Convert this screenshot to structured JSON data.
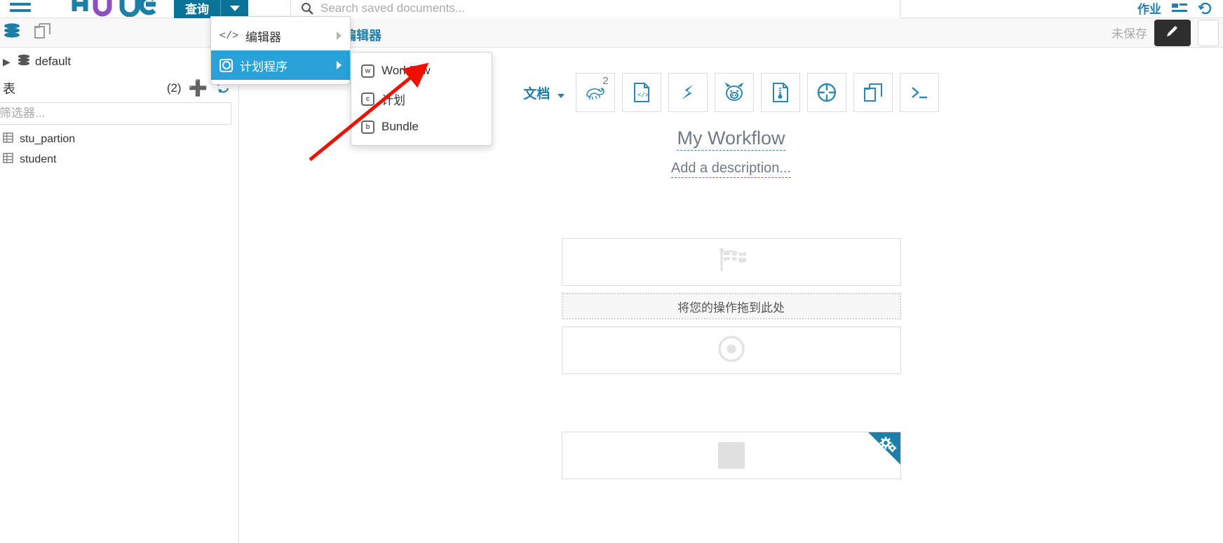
{
  "header": {
    "menu_icon": "hamburger-icon",
    "logo_text": "hue",
    "query_button_label": "查询",
    "search": {
      "placeholder": "Search saved documents...",
      "value": ""
    },
    "jobs_label": "作业",
    "jobs_icon": "jobs-list-icon",
    "history_icon": "history-icon"
  },
  "subbar": {
    "db_icon": "database-icon",
    "docs_icon": "documents-icon",
    "trash_icon": "trash-icon",
    "editor_tab_label": "编辑器",
    "unsaved_label": "未保存",
    "edit_icon": "pencil-icon"
  },
  "dropdown": {
    "items": [
      {
        "label": "编辑器",
        "icon": "code-icon",
        "active": false,
        "has_submenu": true
      },
      {
        "label": "计划程序",
        "icon": "scheduler-icon",
        "active": true,
        "has_submenu": true
      }
    ]
  },
  "submenu": {
    "items": [
      {
        "label": "Workflow",
        "icon": "workflow-icon",
        "badge": "w"
      },
      {
        "label": "计划",
        "icon": "coordinator-icon",
        "badge": "c"
      },
      {
        "label": "Bundle",
        "icon": "bundle-icon",
        "badge": "b"
      }
    ]
  },
  "sidebar": {
    "database": {
      "name": "default",
      "icon": "database-icon"
    },
    "tables_label": "表",
    "tables_count": "(2)",
    "add_icon": "plus-icon",
    "refresh_icon": "refresh-icon",
    "filter": {
      "placeholder": "筛选器...",
      "value": ""
    },
    "tables": [
      {
        "name": "stu_partion",
        "icon": "table-icon"
      },
      {
        "name": "student",
        "icon": "table-icon"
      }
    ]
  },
  "main": {
    "docs_label": "文档",
    "tools": [
      {
        "name": "hive-icon",
        "badge": "2"
      },
      {
        "name": "code-document-icon",
        "badge": ""
      },
      {
        "name": "spark-icon",
        "badge": ""
      },
      {
        "name": "pig-icon",
        "badge": ""
      },
      {
        "name": "java-jar-icon",
        "badge": ""
      },
      {
        "name": "shell-circle-icon",
        "badge": ""
      },
      {
        "name": "distcp-copy-icon",
        "badge": ""
      },
      {
        "name": "terminal-icon",
        "badge": ""
      }
    ],
    "workflow_title": "My Workflow",
    "workflow_description": "Add a description...",
    "nodes": [
      {
        "type": "start",
        "icon": "flag-checkered-icon",
        "label": ""
      },
      {
        "type": "dropzone",
        "icon": "",
        "label": "将您的操作拖到此处"
      },
      {
        "type": "end",
        "icon": "target-circle-icon",
        "label": ""
      },
      {
        "type": "kill",
        "icon": "stop-square-icon",
        "label": "",
        "ribbon_icon": "gears-icon"
      }
    ]
  },
  "annotation": {
    "arrow_color": "#ee1100",
    "arrow_name": "red-pointer-arrow"
  },
  "colors": {
    "brand_blue": "#0b7397",
    "accent_blue": "#29a2d8",
    "link_blue": "#1f7eaa",
    "ribbon_blue": "#1b7fa8"
  }
}
